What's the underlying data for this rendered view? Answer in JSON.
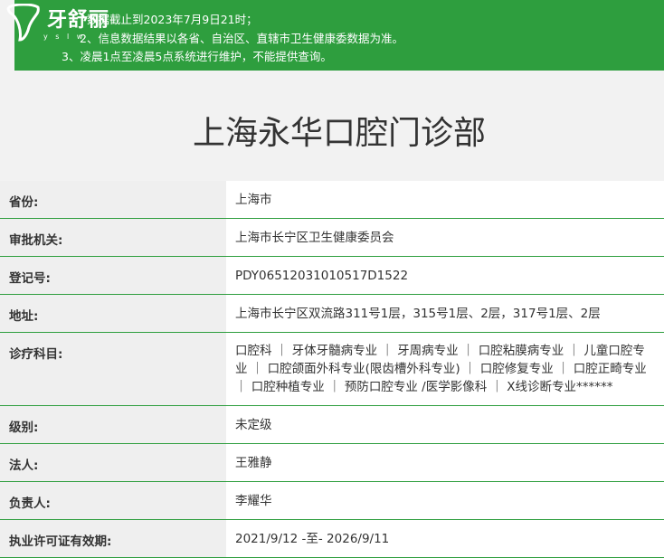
{
  "notice": {
    "line1": "数据截止到2023年7月9日21时；",
    "line2": "2、信息数据结果以各省、自治区、直辖市卫生健康委数据为准。",
    "line3": "3、凌晨1点至凌晨5点系统进行维护，不能提供查询。"
  },
  "logo": {
    "brand": "牙舒丽",
    "sub": "y s l w"
  },
  "page_title": "上海永华口腔门诊部",
  "rows": [
    {
      "label": "省份:",
      "value": "上海市"
    },
    {
      "label": "审批机关:",
      "value": "上海市长宁区卫生健康委员会"
    },
    {
      "label": "登记号:",
      "value": "PDY06512031010517D1522"
    },
    {
      "label": "地址:",
      "value": "上海市长宁区双流路311号1层，315号1层、2层，317号1层、2层"
    },
    {
      "label": "诊疗科目:",
      "value": "口腔科 ｜ 牙体牙髓病专业 ｜ 牙周病专业 ｜ 口腔粘膜病专业 ｜ 儿童口腔专业 ｜ 口腔颌面外科专业(限齿槽外科专业) ｜ 口腔修复专业 ｜ 口腔正畸专业 ｜ 口腔种植专业 ｜ 预防口腔专业 /医学影像科 ｜ X线诊断专业******"
    },
    {
      "label": "级别:",
      "value": "未定级"
    },
    {
      "label": "法人:",
      "value": "王雅静"
    },
    {
      "label": "负责人:",
      "value": "李耀华"
    },
    {
      "label": "执业许可证有效期:",
      "value": "2021/9/12 -至- 2026/9/11"
    }
  ],
  "colors": {
    "accent": "#2e9e3e",
    "label_bg": "#efefef",
    "value_bg": "#ffffff"
  }
}
